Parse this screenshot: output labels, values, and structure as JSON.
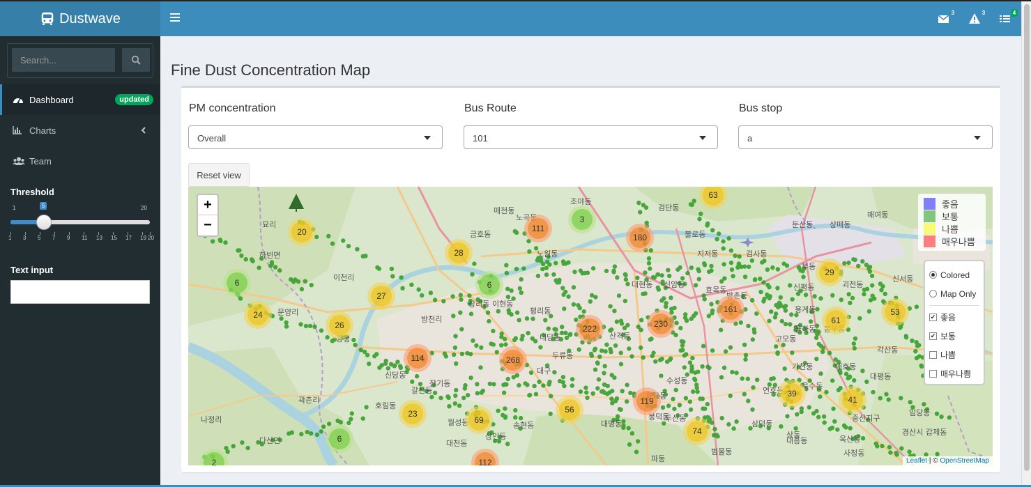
{
  "app": {
    "brand": "Dustwave"
  },
  "navbar": {
    "messages_count": "3",
    "alerts_count": "3",
    "tasks_count": "4"
  },
  "sidebar": {
    "search_placeholder": "Search...",
    "items": [
      {
        "label": "Dashboard",
        "badge": "updated",
        "icon": "dashboard-icon"
      },
      {
        "label": "Charts",
        "icon": "bar-chart-icon"
      },
      {
        "label": "Team",
        "icon": "users-icon"
      }
    ],
    "slider": {
      "label": "Threshold",
      "min": "1",
      "max": "20",
      "value": "5",
      "ticks": [
        "1",
        "3",
        "5",
        "7",
        "9",
        "11",
        "13",
        "15",
        "17",
        "19",
        "20"
      ]
    },
    "text_input": {
      "label": "Text input",
      "value": ""
    }
  },
  "main": {
    "title": "Fine Dust Concentration Map",
    "filters": [
      {
        "label": "PM concentration",
        "value": "Overall"
      },
      {
        "label": "Bus Route",
        "value": "101"
      },
      {
        "label": "Bus stop",
        "value": "a"
      }
    ],
    "reset_label": "Reset view"
  },
  "map": {
    "zoom_in": "+",
    "zoom_out": "−",
    "legend": [
      {
        "label": "좋음",
        "color": "#7f7ff7"
      },
      {
        "label": "보통",
        "color": "#80c67c"
      },
      {
        "label": "나쁨",
        "color": "#fafa7a"
      },
      {
        "label": "매우나쁨",
        "color": "#fa7f7f"
      }
    ],
    "layers": {
      "base": [
        {
          "label": "Colored",
          "selected": true
        },
        {
          "label": "Map Only",
          "selected": false
        }
      ],
      "overlays": [
        {
          "label": "좋음",
          "checked": true
        },
        {
          "label": "보통",
          "checked": true
        },
        {
          "label": "나쁨",
          "checked": false
        },
        {
          "label": "매우나쁨",
          "checked": false
        }
      ]
    },
    "attribution_leaflet": "Leaflet",
    "attribution_sep": " | © ",
    "attribution_osm": "OpenStreetMap",
    "clusters": [
      {
        "count": "63",
        "level": "yellow"
      },
      {
        "count": "20",
        "level": "yellow"
      },
      {
        "count": "111",
        "level": "orange"
      },
      {
        "count": "3",
        "level": "green"
      },
      {
        "count": "180",
        "level": "orange"
      },
      {
        "count": "28",
        "level": "yellow"
      },
      {
        "count": "29",
        "level": "yellow"
      },
      {
        "count": "6",
        "level": "green"
      },
      {
        "count": "6",
        "level": "green"
      },
      {
        "count": "27",
        "level": "yellow"
      },
      {
        "count": "24",
        "level": "yellow"
      },
      {
        "count": "26",
        "level": "yellow"
      },
      {
        "count": "161",
        "level": "orange"
      },
      {
        "count": "53",
        "level": "yellow"
      },
      {
        "count": "61",
        "level": "yellow"
      },
      {
        "count": "222",
        "level": "orange"
      },
      {
        "count": "230",
        "level": "orange"
      },
      {
        "count": "114",
        "level": "orange"
      },
      {
        "count": "268",
        "level": "orange"
      },
      {
        "count": "39",
        "level": "yellow"
      },
      {
        "count": "41",
        "level": "yellow"
      },
      {
        "count": "56",
        "level": "yellow"
      },
      {
        "count": "119",
        "level": "orange"
      },
      {
        "count": "23",
        "level": "yellow"
      },
      {
        "count": "69",
        "level": "yellow"
      },
      {
        "count": "74",
        "level": "yellow"
      },
      {
        "count": "6",
        "level": "green"
      },
      {
        "count": "2",
        "level": "green"
      },
      {
        "count": "112",
        "level": "orange"
      }
    ],
    "place_labels": [
      "금호동",
      "매천동",
      "노곡동",
      "조야동",
      "검단동",
      "불로동",
      "지저동",
      "검사동",
      "둔산동",
      "상매동",
      "매여동",
      "이현동",
      "평리동",
      "대현동",
      "신암동",
      "효목동",
      "방촌동",
      "신서동",
      "부동",
      "신평동",
      "괴전동",
      "용계동",
      "율하동",
      "봉무동",
      "고모동",
      "각산동",
      "가천동",
      "매호동",
      "대평동",
      "연호동",
      "욱수동",
      "신당동",
      "갈산동",
      "장기동",
      "호림동",
      "월성동",
      "대천동",
      "상인동",
      "송현동",
      "대명동",
      "대구",
      "봉덕동",
      "수성동",
      "황금동",
      "파동",
      "범물동",
      "상동",
      "두산동",
      "삼덕동",
      "대흥동",
      "옥산동",
      "경산시",
      "사정동",
      "갑제동",
      "중산지구",
      "임당동",
      "다산면",
      "하빈면",
      "강정",
      "문양리",
      "방천리",
      "이천리",
      "나정리",
      "곽촌리",
      "묘리",
      "상리동",
      "두류동",
      "내당동",
      "산격동",
      "노원동"
    ]
  }
}
